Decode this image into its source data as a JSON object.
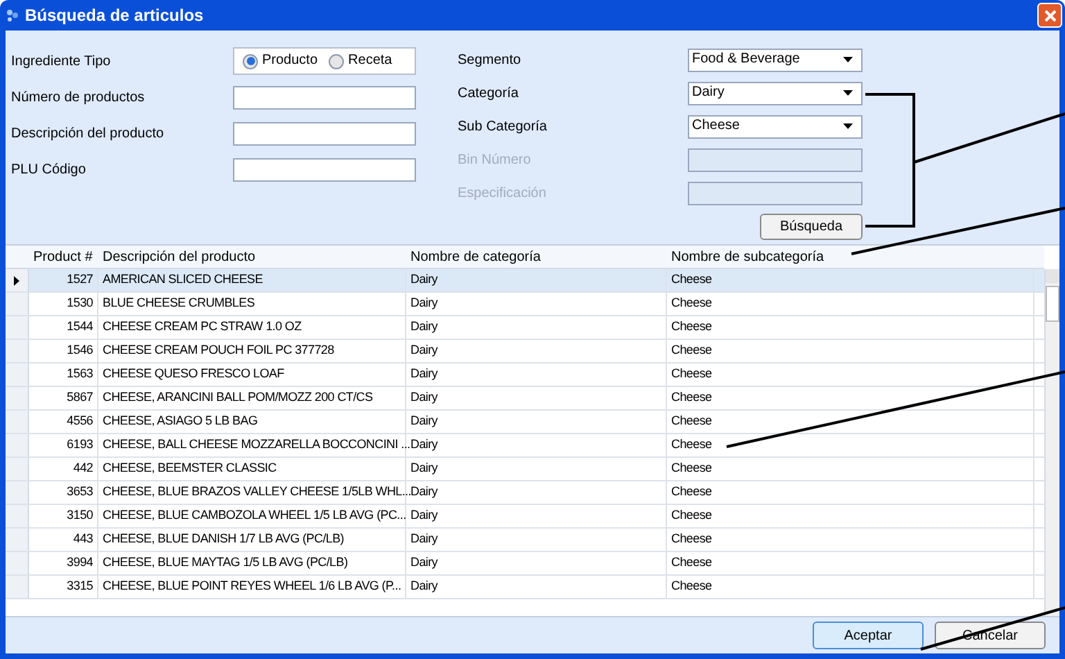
{
  "window": {
    "title": "Búsqueda de articulos"
  },
  "form_left": [
    {
      "kind": "radio",
      "label": "Ingrediente Tipo",
      "options": [
        {
          "label": "Producto",
          "selected": true
        },
        {
          "label": "Receta",
          "selected": false
        }
      ]
    },
    {
      "kind": "text",
      "label": "Número de productos"
    },
    {
      "kind": "text",
      "label": "Descripción del producto"
    },
    {
      "kind": "text",
      "label": "PLU Código"
    }
  ],
  "form_right": [
    {
      "kind": "dropdown",
      "label": "Segmento",
      "value": "Food & Beverage",
      "disabled": false
    },
    {
      "kind": "dropdown",
      "label": "Categoría",
      "value": "Dairy",
      "disabled": false
    },
    {
      "kind": "dropdown",
      "label": "Sub Categoría",
      "value": "Cheese",
      "disabled": false
    },
    {
      "kind": "text",
      "label": "Bin Número",
      "disabled": true
    },
    {
      "kind": "text",
      "label": "Especificación",
      "disabled": true
    }
  ],
  "search_button": "Búsqueda",
  "table": {
    "columns": [
      "Product #",
      "Descripción del producto",
      "Nombre de categoría",
      "Nombre de subcategoría"
    ],
    "rows": [
      {
        "cells": [
          "1527",
          "AMERICAN SLICED CHEESE",
          "Dairy",
          "Cheese"
        ],
        "selected": true
      },
      {
        "cells": [
          "1530",
          "BLUE CHEESE CRUMBLES",
          "Dairy",
          "Cheese"
        ],
        "selected": false
      },
      {
        "cells": [
          "1544",
          "CHEESE CREAM PC STRAW 1.0 OZ",
          "Dairy",
          "Cheese"
        ],
        "selected": false
      },
      {
        "cells": [
          "1546",
          "CHEESE CREAM POUCH FOIL PC 377728",
          "Dairy",
          "Cheese"
        ],
        "selected": false
      },
      {
        "cells": [
          "1563",
          "CHEESE QUESO FRESCO LOAF",
          "Dairy",
          "Cheese"
        ],
        "selected": false
      },
      {
        "cells": [
          "5867",
          "CHEESE, ARANCINI BALL POM/MOZZ 200 CT/CS",
          "Dairy",
          "Cheese"
        ],
        "selected": false
      },
      {
        "cells": [
          "4556",
          "CHEESE, ASIAGO 5 LB BAG",
          "Dairy",
          "Cheese"
        ],
        "selected": false
      },
      {
        "cells": [
          "6193",
          "CHEESE, BALL CHEESE MOZZARELLA BOCCONCINI ...",
          "Dairy",
          "Cheese"
        ],
        "selected": false
      },
      {
        "cells": [
          "442",
          "CHEESE, BEEMSTER CLASSIC",
          "Dairy",
          "Cheese"
        ],
        "selected": false
      },
      {
        "cells": [
          "3653",
          "CHEESE, BLUE BRAZOS VALLEY CHEESE 1/5LB WHL...",
          "Dairy",
          "Cheese"
        ],
        "selected": false
      },
      {
        "cells": [
          "3150",
          "CHEESE, BLUE CAMBOZOLA WHEEL 1/5 LB AVG (PC...",
          "Dairy",
          "Cheese"
        ],
        "selected": false
      },
      {
        "cells": [
          "443",
          "CHEESE, BLUE DANISH 1/7 LB AVG (PC/LB)",
          "Dairy",
          "Cheese"
        ],
        "selected": false
      },
      {
        "cells": [
          "3994",
          "CHEESE, BLUE MAYTAG 1/5 LB AVG (PC/LB)",
          "Dairy",
          "Cheese"
        ],
        "selected": false
      },
      {
        "cells": [
          "3315",
          "CHEESE, BLUE POINT REYES WHEEL 1/6 LB AVG (P...",
          "Dairy",
          "Cheese"
        ],
        "selected": false
      }
    ]
  },
  "buttons": [
    "Aceptar",
    "Cancelar"
  ]
}
